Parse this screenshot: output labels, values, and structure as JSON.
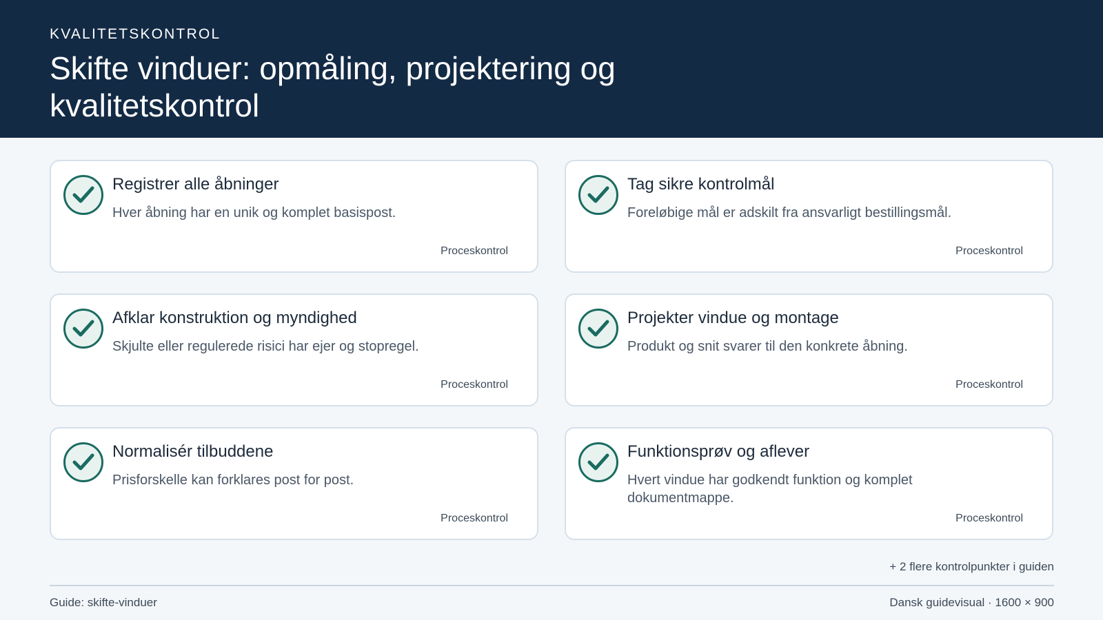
{
  "header": {
    "eyebrow": "KVALITETSKONTROL",
    "title": "Skifte vinduer: opmåling, projektering og kvalitetskontrol"
  },
  "cards": [
    {
      "title": "Registrer alle åbninger",
      "description": "Hver åbning har en unik og komplet basispost.",
      "tag": "Proceskontrol",
      "icon": "check-circle-icon"
    },
    {
      "title": "Tag sikre kontrolmål",
      "description": "Foreløbige mål er adskilt fra ansvarligt bestillingsmål.",
      "tag": "Proceskontrol",
      "icon": "check-circle-icon"
    },
    {
      "title": "Afklar konstruktion og myndighed",
      "description": "Skjulte eller regulerede risici har ejer og stopregel.",
      "tag": "Proceskontrol",
      "icon": "check-circle-icon"
    },
    {
      "title": "Projekter vindue og montage",
      "description": "Produkt og snit svarer til den konkrete åbning.",
      "tag": "Proceskontrol",
      "icon": "check-circle-icon"
    },
    {
      "title": "Normalisér tilbuddene",
      "description": "Prisforskelle kan forklares post for post.",
      "tag": "Proceskontrol",
      "icon": "check-circle-icon"
    },
    {
      "title": "Funktionsprøv og aflever",
      "description": "Hvert vindue har godkendt funktion og komplet dokumentmappe.",
      "tag": "Proceskontrol",
      "icon": "check-circle-icon"
    }
  ],
  "more_text": "+ 2 flere kontrolpunkter i guiden",
  "footer": {
    "left": "Guide: skifte-vinduer",
    "right": "Dansk guidevisual · 1600 × 900"
  },
  "colors": {
    "header_bg": "#132a45",
    "accent": "#1a6b60",
    "card_border": "#d5e0ea",
    "page_bg": "#f4f7fa"
  }
}
